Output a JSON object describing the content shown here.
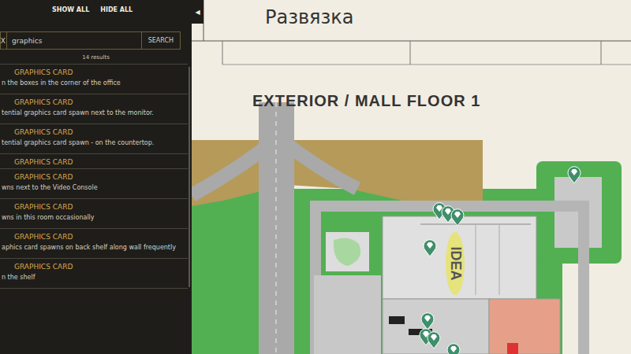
{
  "sidebar": {
    "show_all": "SHOW ALL",
    "hide_all": "HIDE ALL",
    "search": {
      "clear": "X",
      "value": "graphics",
      "button": "SEARCH"
    },
    "results": "14 results",
    "items": [
      {
        "title": "GRAPHICS CARD",
        "description": "n the boxes in the corner of the office"
      },
      {
        "title": "GRAPHICS CARD",
        "description": "tential graphics card spawn next to the monitor."
      },
      {
        "title": "GRAPHICS CARD",
        "description": "tential graphics card spawn - on the countertop."
      },
      {
        "title": "GRAPHICS CARD"
      },
      {
        "title": "GRAPHICS CARD",
        "description": "wns next to the Video Console"
      },
      {
        "title": "GRAPHICS CARD",
        "description": "wns in this room occasionally"
      },
      {
        "title": "GRAPHICS CARD",
        "description": "aphics card spawns on back shelf along wall frequently"
      },
      {
        "title": "GRAPHICS CARD",
        "description": "n the shelf"
      }
    ]
  },
  "collapse": "◀",
  "map": {
    "title": "Развязка",
    "floor": "EXTERIOR / MALL FLOOR 1",
    "store_label": "IDEA"
  }
}
